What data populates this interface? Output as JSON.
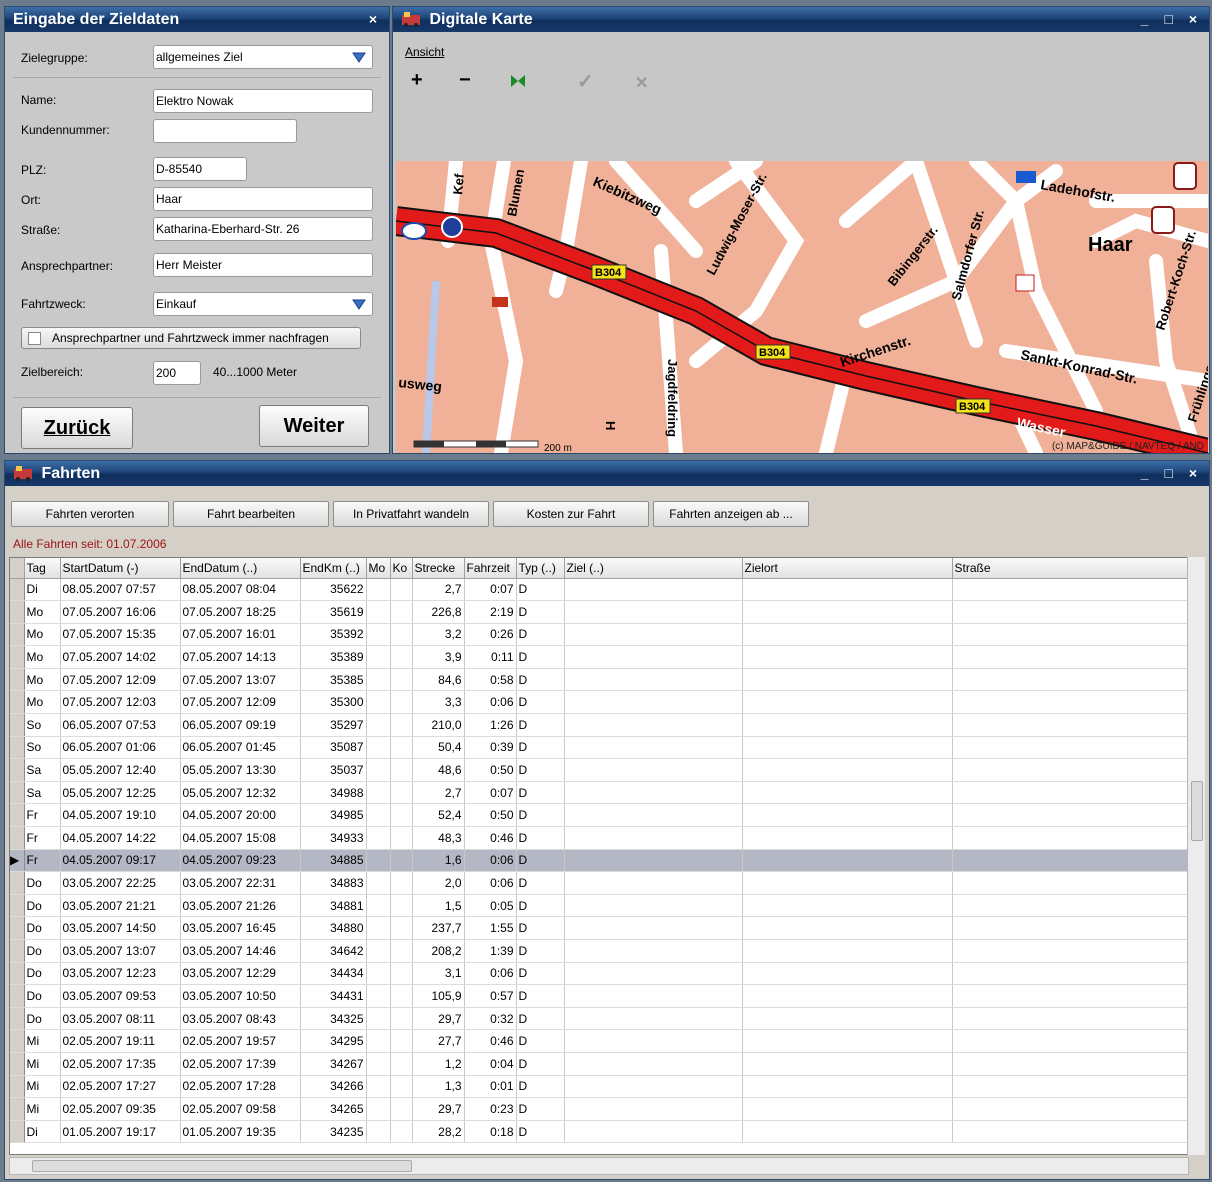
{
  "form": {
    "title": "Eingabe der Zieldaten",
    "close": "×",
    "zielegruppe_label": "Zielegruppe:",
    "zielegruppe_value": "allgemeines Ziel",
    "name_label": "Name:",
    "name_value": "Elektro Nowak",
    "kundennummer_label": "Kundennummer:",
    "kundennummer_value": "",
    "plz_label": "PLZ:",
    "plz_value": "D-85540",
    "ort_label": "Ort:",
    "ort_value": "Haar",
    "strasse_label": "Straße:",
    "strasse_value": "Katharina-Eberhard-Str. 26",
    "ansprechpartner_label": "Ansprechpartner:",
    "ansprechpartner_value": "Herr Meister",
    "fahrtzweck_label": "Fahrtzweck:",
    "fahrtzweck_value": "Einkauf",
    "checkbox_label": "Ansprechpartner und Fahrtzweck immer nachfragen",
    "zielbereich_label": "Zielbereich:",
    "zielbereich_value": "200",
    "zielbereich_hint": "40...1000 Meter",
    "back_button": "Zurück",
    "next_button": "Weiter"
  },
  "map": {
    "title": "Digitale Karte",
    "controls": "_ □ ×",
    "menu_ansicht": "Ansicht",
    "scale_label": "200 m",
    "copyright": "(c) MAP&GUIDE / NAVTEQ / AND",
    "town": "Haar",
    "streets": [
      "Kiebitzweg",
      "Ludwig-Moser-Str.",
      "Bibingerstr.",
      "Salmdorfer Str.",
      "Ladehofstr.",
      "Robert-Koch-Str.",
      "Kirchenstr.",
      "Sankt-Konrad-Str.",
      "Frühlingsweg",
      "Jagdfeldring",
      "Blumen",
      "Kef",
      "usweg",
      "Wasser",
      "H"
    ],
    "road_badge": "B304"
  },
  "trips": {
    "title": "Fahrten",
    "controls": "_ □ ×",
    "buttons": [
      "Fahrten verorten",
      "Fahrt bearbeiten",
      "In Privatfahrt wandeln",
      "Kosten zur Fahrt",
      "Fahrten anzeigen ab ..."
    ],
    "since": "Alle Fahrten seit: 01.07.2006",
    "columns": [
      "Tag",
      "StartDatum (-)",
      "EndDatum (..)",
      "EndKm (..)",
      "Mo",
      "Ko",
      "Strecke",
      "Fahrzeit",
      "Typ (..)",
      "Ziel (..)",
      "Zielort",
      "Straße"
    ],
    "selected_index": 12,
    "rows": [
      [
        "Di",
        "08.05.2007 07:57",
        "08.05.2007 08:04",
        "35622",
        "2,7",
        "0:07",
        "D"
      ],
      [
        "Mo",
        "07.05.2007 16:06",
        "07.05.2007 18:25",
        "35619",
        "226,8",
        "2:19",
        "D"
      ],
      [
        "Mo",
        "07.05.2007 15:35",
        "07.05.2007 16:01",
        "35392",
        "3,2",
        "0:26",
        "D"
      ],
      [
        "Mo",
        "07.05.2007 14:02",
        "07.05.2007 14:13",
        "35389",
        "3,9",
        "0:11",
        "D"
      ],
      [
        "Mo",
        "07.05.2007 12:09",
        "07.05.2007 13:07",
        "35385",
        "84,6",
        "0:58",
        "D"
      ],
      [
        "Mo",
        "07.05.2007 12:03",
        "07.05.2007 12:09",
        "35300",
        "3,3",
        "0:06",
        "D"
      ],
      [
        "So",
        "06.05.2007 07:53",
        "06.05.2007 09:19",
        "35297",
        "210,0",
        "1:26",
        "D"
      ],
      [
        "So",
        "06.05.2007 01:06",
        "06.05.2007 01:45",
        "35087",
        "50,4",
        "0:39",
        "D"
      ],
      [
        "Sa",
        "05.05.2007 12:40",
        "05.05.2007 13:30",
        "35037",
        "48,6",
        "0:50",
        "D"
      ],
      [
        "Sa",
        "05.05.2007 12:25",
        "05.05.2007 12:32",
        "34988",
        "2,7",
        "0:07",
        "D"
      ],
      [
        "Fr",
        "04.05.2007 19:10",
        "04.05.2007 20:00",
        "34985",
        "52,4",
        "0:50",
        "D"
      ],
      [
        "Fr",
        "04.05.2007 14:22",
        "04.05.2007 15:08",
        "34933",
        "48,3",
        "0:46",
        "D"
      ],
      [
        "Fr",
        "04.05.2007 09:17",
        "04.05.2007 09:23",
        "34885",
        "1,6",
        "0:06",
        "D"
      ],
      [
        "Do",
        "03.05.2007 22:25",
        "03.05.2007 22:31",
        "34883",
        "2,0",
        "0:06",
        "D"
      ],
      [
        "Do",
        "03.05.2007 21:21",
        "03.05.2007 21:26",
        "34881",
        "1,5",
        "0:05",
        "D"
      ],
      [
        "Do",
        "03.05.2007 14:50",
        "03.05.2007 16:45",
        "34880",
        "237,7",
        "1:55",
        "D"
      ],
      [
        "Do",
        "03.05.2007 13:07",
        "03.05.2007 14:46",
        "34642",
        "208,2",
        "1:39",
        "D"
      ],
      [
        "Do",
        "03.05.2007 12:23",
        "03.05.2007 12:29",
        "34434",
        "3,1",
        "0:06",
        "D"
      ],
      [
        "Do",
        "03.05.2007 09:53",
        "03.05.2007 10:50",
        "34431",
        "105,9",
        "0:57",
        "D"
      ],
      [
        "Do",
        "03.05.2007 08:11",
        "03.05.2007 08:43",
        "34325",
        "29,7",
        "0:32",
        "D"
      ],
      [
        "Mi",
        "02.05.2007 19:11",
        "02.05.2007 19:57",
        "34295",
        "27,7",
        "0:46",
        "D"
      ],
      [
        "Mi",
        "02.05.2007 17:35",
        "02.05.2007 17:39",
        "34267",
        "1,2",
        "0:04",
        "D"
      ],
      [
        "Mi",
        "02.05.2007 17:27",
        "02.05.2007 17:28",
        "34266",
        "1,3",
        "0:01",
        "D"
      ],
      [
        "Mi",
        "02.05.2007 09:35",
        "02.05.2007 09:58",
        "34265",
        "29,7",
        "0:23",
        "D"
      ],
      [
        "Di",
        "01.05.2007 19:17",
        "01.05.2007 19:35",
        "34235",
        "28,2",
        "0:18",
        "D"
      ]
    ]
  }
}
